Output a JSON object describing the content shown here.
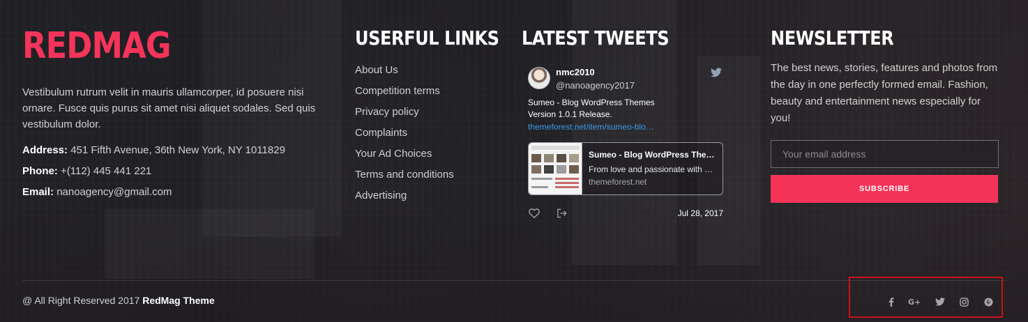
{
  "brand": {
    "name": "REDMAG"
  },
  "about": {
    "text": "Vestibulum rutrum velit in mauris ullamcorper, id posuere nisi ornare. Fusce quis purus sit amet nisi aliquet sodales. Sed quis vestibulum dolor.",
    "address_label": "Address:",
    "address": "451 Fifth Avenue, 36th New York, NY 1011829",
    "phone_label": "Phone:",
    "phone": "+(112) 445 441 221",
    "email_label": "Email:",
    "email": "nanoagency@gmail.com"
  },
  "links": {
    "heading": "USERFUL LINKS",
    "items": [
      "About Us",
      "Competition terms",
      "Privacy policy",
      "Complaints",
      "Your Ad Choices",
      "Terms and conditions",
      "Advertising"
    ]
  },
  "tweets": {
    "heading": "LATEST TWEETS",
    "name": "nmc2010",
    "handle": "@nanoagency2017",
    "text": "Sumeo - Blog WordPress Themes\n Version 1.0.1 Release.",
    "link": "themeforest.net/item/sumeo-blo…",
    "card": {
      "title": "Sumeo - Blog WordPress The…",
      "description": "From love and passionate with …",
      "domain": "themeforest.net"
    },
    "date": "Jul 28, 2017",
    "icons": [
      "twitter-bird-icon",
      "heart-icon",
      "share-icon"
    ]
  },
  "newsletter": {
    "heading": "NEWSLETTER",
    "text": "The best news, stories, features and photos from the day in one perfectly formed email. Fashion, beauty and entertainment news especially for you!",
    "email_placeholder": "Your email address",
    "email_value": "",
    "button": "SUBSCRIBE"
  },
  "footer": {
    "copyright_prefix": "@ All Right Reserved 2017",
    "copyright_brand": "RedMag Theme",
    "social": [
      "facebook-icon",
      "google-plus-icon",
      "twitter-icon",
      "instagram-icon",
      "pinterest-icon"
    ],
    "highlight_color": "#c8131f"
  },
  "colors": {
    "accent": "#f5345a",
    "link": "#3b9ae8"
  }
}
